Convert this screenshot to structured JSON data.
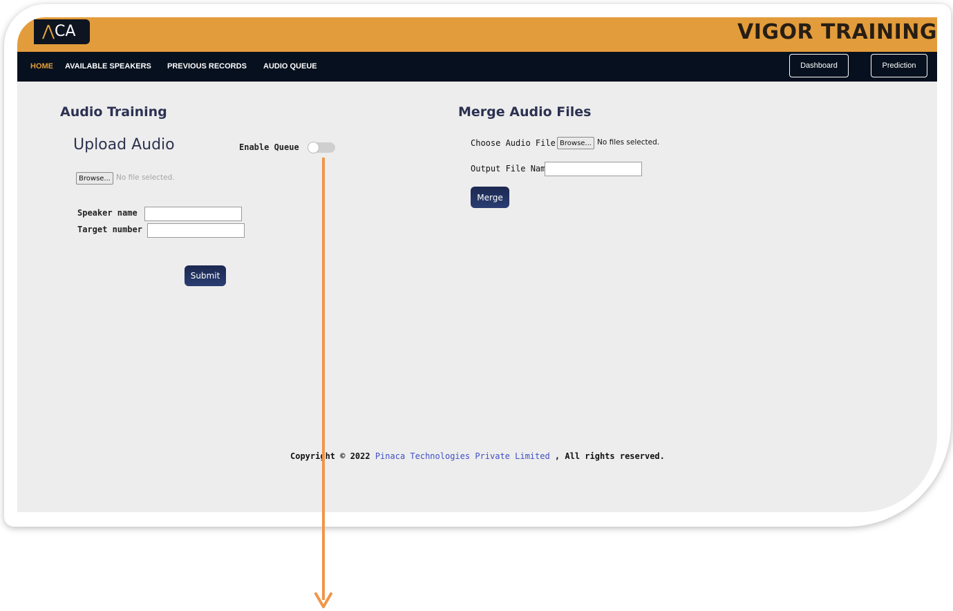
{
  "header": {
    "logo_text": "NACA",
    "logo_visible_prefix": "",
    "logo_visible": "CA",
    "brand": "VIGOR TRAINING"
  },
  "nav": {
    "links": [
      "HOME",
      "AVAILABLE SPEAKERS",
      "PREVIOUS RECORDS",
      "AUDIO QUEUE"
    ],
    "active": "HOME",
    "dashboard_label": "Dashboard",
    "prediction_label": "Prediction"
  },
  "audio_training": {
    "title": "Audio Training",
    "upload_title": "Upload Audio",
    "queue_label": "Enable Queue",
    "queue_enabled": false,
    "browse_label": "Browse...",
    "file_status": "No file selected.",
    "speaker_label": "Speaker name",
    "speaker_value": "",
    "target_label": "Target number",
    "target_value": "",
    "submit_label": "Submit"
  },
  "merge": {
    "title": "Merge Audio Files",
    "choose_label": "Choose Audio File(s)",
    "browse_label": "Browse...",
    "file_status": "No files selected.",
    "output_label": "Output File Name",
    "output_value": "",
    "merge_label": "Merge"
  },
  "footer": {
    "prefix": "Copyright © 2022 ",
    "company": "Pinaca Technologies Private Limited",
    "suffix": " , All rights reserved."
  },
  "colors": {
    "header_bg": "#e39c3b",
    "navbar_bg": "#06101e",
    "accent": "#e39c3b",
    "button_bg": "#1f2e5a",
    "annotation_arrow": "#f0954a"
  }
}
